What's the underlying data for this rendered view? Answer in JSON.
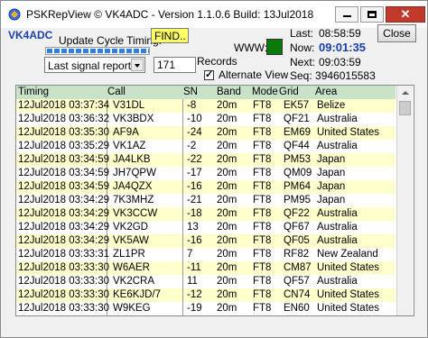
{
  "window": {
    "title": "PSKRepView © VK4ADC - Version 1.1.0.6  Build: 13Jul2018"
  },
  "header": {
    "callsign": "VK4ADC",
    "update_cycle_label": "Update Cycle Timing:",
    "update_cycle_value": "FIND..",
    "www_label": "WWW:",
    "last_label": "Last:",
    "last_time": "08:58:59",
    "now_label": "Now:",
    "now_time": "09:01:35",
    "next_label": "Next:",
    "next_time": "09:03:59",
    "seq_text": "Seq: 3946015583",
    "close_label": "Close",
    "report_select": "Last signal reports",
    "records_value": "171",
    "records_label": "Records",
    "alternate_view_label": "Alternate View",
    "alternate_view_checked": true,
    "status_led_color": "#0b7a0b"
  },
  "table": {
    "columns": [
      "Timing",
      "Call",
      "SN",
      "Band",
      "Mode",
      "Grid",
      "Area"
    ],
    "rows": [
      [
        "12Jul2018 03:37:34",
        "V31DL",
        "-8",
        "20m",
        "FT8",
        "EK57",
        "Belize"
      ],
      [
        "12Jul2018 03:36:32",
        "VK3BDX",
        "-10",
        "20m",
        "FT8",
        "QF21",
        "Australia"
      ],
      [
        "12Jul2018 03:35:30",
        "AF9A",
        "-24",
        "20m",
        "FT8",
        "EM69",
        "United States"
      ],
      [
        "12Jul2018 03:35:29",
        "VK1AZ",
        "-2",
        "20m",
        "FT8",
        "QF44",
        "Australia"
      ],
      [
        "12Jul2018 03:34:59",
        "JA4LKB",
        "-22",
        "20m",
        "FT8",
        "PM53",
        "Japan"
      ],
      [
        "12Jul2018 03:34:59",
        "JH7QPW",
        "-17",
        "20m",
        "FT8",
        "QM09",
        "Japan"
      ],
      [
        "12Jul2018 03:34:59",
        "JA4QZX",
        "-16",
        "20m",
        "FT8",
        "PM64",
        "Japan"
      ],
      [
        "12Jul2018 03:34:29",
        "7K3MHZ",
        "-21",
        "20m",
        "FT8",
        "PM95",
        "Japan"
      ],
      [
        "12Jul2018 03:34:29",
        "VK3CCW",
        "-18",
        "20m",
        "FT8",
        "QF22",
        "Australia"
      ],
      [
        "12Jul2018 03:34:29",
        "VK2GD",
        "13",
        "20m",
        "FT8",
        "QF67",
        "Australia"
      ],
      [
        "12Jul2018 03:34:29",
        "VK5AW",
        "-16",
        "20m",
        "FT8",
        "QF05",
        "Australia"
      ],
      [
        "12Jul2018 03:33:31",
        "ZL1PR",
        "7",
        "20m",
        "FT8",
        "RF82",
        "New Zealand"
      ],
      [
        "12Jul2018 03:33:30",
        "W6AER",
        "-11",
        "20m",
        "FT8",
        "CM87",
        "United States"
      ],
      [
        "12Jul2018 03:33:30",
        "VK2CRA",
        "11",
        "20m",
        "FT8",
        "QF57",
        "Australia"
      ],
      [
        "12Jul2018 03:33:30",
        "KE6KJD/7",
        "-12",
        "20m",
        "FT8",
        "CN74",
        "United States"
      ],
      [
        "12Jul2018 03:33:30",
        "W9KEG",
        "-19",
        "20m",
        "FT8",
        "EN60",
        "United States"
      ]
    ]
  }
}
